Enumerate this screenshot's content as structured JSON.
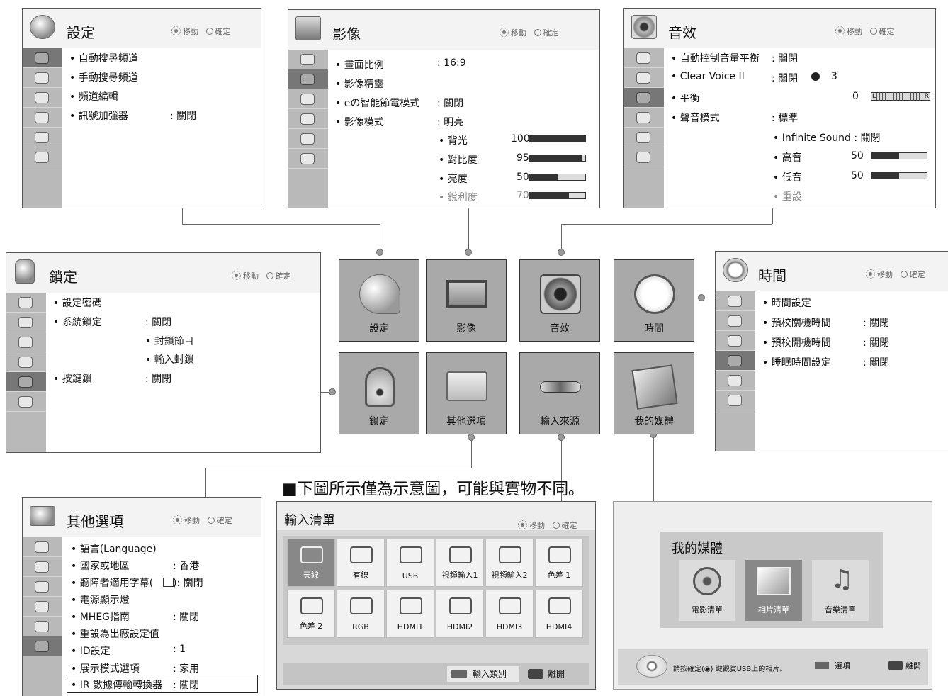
{
  "hint_move": "移動",
  "hint_ok": "確定",
  "settings_panel": {
    "title": "設定",
    "items": [
      "• 自動搜尋頻道",
      "• 手動搜尋頻道",
      "• 頻道編輯",
      "• 訊號加強器"
    ],
    "signal_value": ": 關閉"
  },
  "picture_panel": {
    "title": "影像",
    "items": [
      "• 畫面比例",
      "• 影像精靈",
      "• eの智能節電模式",
      "• 影像模式"
    ],
    "values": [
      ": 16:9",
      "",
      ": 關閉",
      ": 明亮"
    ],
    "sub_items": [
      {
        "label": "• 背光",
        "value": "100",
        "level": 100
      },
      {
        "label": "• 對比度",
        "value": "95",
        "level": 95
      },
      {
        "label": "• 亮度",
        "value": "50",
        "level": 50
      },
      {
        "label": "• 銳利度",
        "value": "70",
        "level": 70
      }
    ]
  },
  "audio_panel": {
    "title": "音效",
    "items": [
      "• 自動控制音量平衡",
      "• Clear Voice II",
      "• 平衡",
      "• 聲音模式"
    ],
    "values": [
      ": 關閉",
      ": 關閉",
      "0",
      ": 標準"
    ],
    "clear_voice_level": "3",
    "balance_left": "L",
    "balance_right": "R",
    "infinite_sound": "• Infinite Sound : 關閉",
    "treble": {
      "label": "• 高音",
      "value": "50",
      "level": 50
    },
    "bass": {
      "label": "• 低音",
      "value": "50",
      "level": 50
    },
    "reset": "• 重設"
  },
  "lock_panel": {
    "title": "鎖定",
    "items": [
      "• 設定密碼",
      "• 系統鎖定",
      "• 按鍵鎖"
    ],
    "system_lock_value": ": 關閉",
    "sub_items": [
      "• 封鎖節目",
      "• 輸入封鎖"
    ],
    "key_lock_value": ": 關閉"
  },
  "time_panel": {
    "title": "時間",
    "items": [
      "• 時間設定",
      "• 預校關機時間",
      "• 預校開機時間",
      "• 睡眠時間設定"
    ],
    "values": [
      "",
      ": 關閉",
      ": 關閉",
      ": 關閉"
    ]
  },
  "options_panel": {
    "title": "其他選項",
    "items": [
      "• 語言(Language)",
      "• 國家或地區",
      "• 聽障者適用字幕(",
      "• 電源顯示燈",
      "• MHEG指南",
      "• 重設為出廠設定值",
      "• ID設定",
      "• 展示模式選項",
      "• IR 數據傳輸轉換器"
    ],
    "values": [
      "",
      ": 香港",
      "): 關閉",
      "",
      ": 關閉",
      "",
      ": 1",
      ": 家用",
      ": 關閉"
    ]
  },
  "tiles": [
    {
      "label": "設定",
      "icon": "satellite-dish-icon"
    },
    {
      "label": "影像",
      "icon": "tv-icon"
    },
    {
      "label": "音效",
      "icon": "speaker-icon"
    },
    {
      "label": "時間",
      "icon": "clock-icon"
    },
    {
      "label": "鎖定",
      "icon": "padlock-icon"
    },
    {
      "label": "其他選項",
      "icon": "toolbox-icon"
    },
    {
      "label": "輸入來源",
      "icon": "cable-plug-icon"
    },
    {
      "label": "我的媒體",
      "icon": "media-icon"
    }
  ],
  "note": "■下圖所示僅為示意圖，可能與實物不同。",
  "input_list": {
    "title": "輸入清單",
    "sources": [
      "天線",
      "有線",
      "USB",
      "視頻輸入1",
      "視頻輸入2",
      "色差 1",
      "色差 2",
      "RGB",
      "HDMI1",
      "HDMI2",
      "HDMI3",
      "HDMI4"
    ],
    "input_type": "輸入類別",
    "exit": "離開"
  },
  "my_media": {
    "title": "我的媒體",
    "items": [
      "電影清單",
      "相片清單",
      "音樂清單"
    ],
    "instruction": "請按確定(◉) 鍵觀賞USB上的相片。",
    "option": "選項",
    "exit": "離開"
  }
}
